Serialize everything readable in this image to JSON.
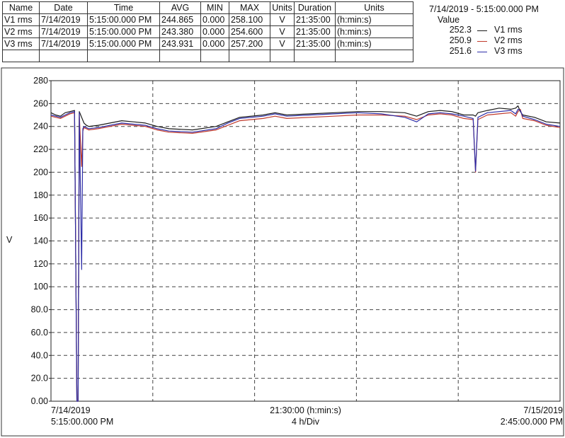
{
  "table": {
    "headers": [
      "Name",
      "Date",
      "Time",
      "AVG",
      "MIN",
      "MAX",
      "Units",
      "Duration",
      "Units"
    ],
    "rows": [
      [
        "V1 rms",
        "7/14/2019",
        "5:15:00.000 PM",
        "244.865",
        "0.000",
        "258.100",
        "V",
        "21:35:00",
        "(h:min:s)"
      ],
      [
        "V2 rms",
        "7/14/2019",
        "5:15:00.000 PM",
        "243.380",
        "0.000",
        "254.600",
        "V",
        "21:35:00",
        "(h:min:s)"
      ],
      [
        "V3 rms",
        "7/14/2019",
        "5:15:00.000 PM",
        "243.931",
        "0.000",
        "257.200",
        "V",
        "21:35:00",
        "(h:min:s)"
      ]
    ]
  },
  "legend": {
    "timestamp": "7/14/2019 - 5:15:00.000 PM",
    "value_header": "Value",
    "items": [
      {
        "value": "252.3",
        "name": "V1 rms"
      },
      {
        "value": "250.9",
        "name": "V2 rms"
      },
      {
        "value": "251.6",
        "name": "V3 rms"
      }
    ]
  },
  "chart_data": {
    "type": "line",
    "ylabel": "V",
    "ylim": [
      0,
      280
    ],
    "y_ticks": [
      "0.00",
      "20.0",
      "40.0",
      "60.0",
      "80.0",
      "100",
      "120",
      "140",
      "160",
      "180",
      "200",
      "220",
      "240",
      "260",
      "280"
    ],
    "x_ticks": [
      {
        "line1": "7/14/2019",
        "line2": "5:15:00.000 PM",
        "align": "left"
      },
      {
        "line1": "21:30:00 (h:min:s)",
        "line2": "4 h/Div",
        "align": "center"
      },
      {
        "line1": "7/15/2019",
        "line2": "2:45:00.000 PM",
        "align": "right"
      }
    ],
    "x_unit": "hours from start",
    "xlim": [
      0,
      21.583
    ],
    "grid": true,
    "series": [
      {
        "name": "V1 rms",
        "color": "#1a1a1a",
        "x": [
          0,
          0.2,
          0.4,
          0.6,
          0.8,
          1.0,
          1.1,
          1.15,
          1.2,
          1.3,
          1.4,
          1.5,
          1.6,
          2,
          2.5,
          3,
          3.5,
          4,
          4.5,
          5,
          6,
          7,
          7.5,
          8,
          9,
          9.5,
          10,
          11,
          12,
          13,
          14,
          15,
          15.5,
          16,
          16.5,
          17,
          17.5,
          17.9,
          18.0,
          18.1,
          18.5,
          19,
          19.5,
          19.7,
          19.8,
          19.9,
          20,
          20.5,
          21,
          21.58
        ],
        "y": [
          252,
          250,
          249,
          252,
          253,
          254,
          0,
          0,
          253,
          248,
          243,
          241,
          240,
          241,
          243,
          245,
          244,
          243,
          240,
          238,
          237,
          240,
          244,
          248,
          250,
          252,
          250,
          251,
          252,
          253,
          253,
          252,
          249,
          253,
          254,
          253,
          250,
          250,
          249,
          252,
          254,
          256,
          255,
          256,
          258,
          253,
          250,
          248,
          244,
          243
        ]
      },
      {
        "name": "V2 rms",
        "color": "#c0392b",
        "x": [
          0,
          0.2,
          0.4,
          0.6,
          0.8,
          1.0,
          1.1,
          1.15,
          1.2,
          1.3,
          1.35,
          1.4,
          1.5,
          1.6,
          2,
          2.5,
          3,
          3.5,
          4,
          4.5,
          5,
          6,
          7,
          7.5,
          8,
          9,
          9.5,
          10,
          11,
          12,
          13,
          14,
          15,
          15.5,
          16,
          16.5,
          17,
          17.5,
          17.9,
          18.0,
          18.1,
          18.5,
          19,
          19.5,
          19.7,
          19.8,
          19.9,
          20,
          20.5,
          21,
          21.58
        ],
        "y": [
          249,
          248,
          247,
          249,
          251,
          252,
          0,
          0,
          250,
          205,
          236,
          239,
          238,
          237,
          238,
          240,
          242,
          241,
          240,
          237,
          235,
          234,
          237,
          241,
          245,
          247,
          249,
          247,
          248,
          249,
          250,
          250,
          249,
          246,
          250,
          251,
          250,
          247,
          246,
          200,
          246,
          250,
          251,
          252,
          249,
          253,
          255,
          247,
          245,
          241,
          239
        ]
      },
      {
        "name": "V3 rms",
        "color": "#2e2ea8",
        "x": [
          0,
          0.2,
          0.4,
          0.6,
          0.8,
          1.0,
          1.1,
          1.15,
          1.2,
          1.3,
          1.35,
          1.4,
          1.5,
          1.6,
          2,
          2.5,
          3,
          3.5,
          4,
          4.5,
          5,
          6,
          7,
          7.5,
          8,
          9,
          9.5,
          10,
          11,
          12,
          13,
          14,
          15,
          15.5,
          16,
          16.5,
          17,
          17.5,
          17.9,
          18.0,
          18.1,
          18.5,
          19,
          19.5,
          19.7,
          19.8,
          19.9,
          20,
          20.5,
          21,
          21.58
        ],
        "y": [
          250,
          249,
          248,
          250,
          252,
          253,
          0,
          0,
          252,
          115,
          238,
          240,
          239,
          238,
          239,
          241,
          243,
          242,
          241,
          238,
          236,
          235,
          238,
          243,
          247,
          249,
          251,
          249,
          250,
          251,
          252,
          251,
          248,
          244,
          251,
          252,
          251,
          249,
          247,
          201,
          248,
          252,
          253,
          254,
          251,
          255,
          254,
          249,
          246,
          242,
          240
        ]
      }
    ]
  }
}
